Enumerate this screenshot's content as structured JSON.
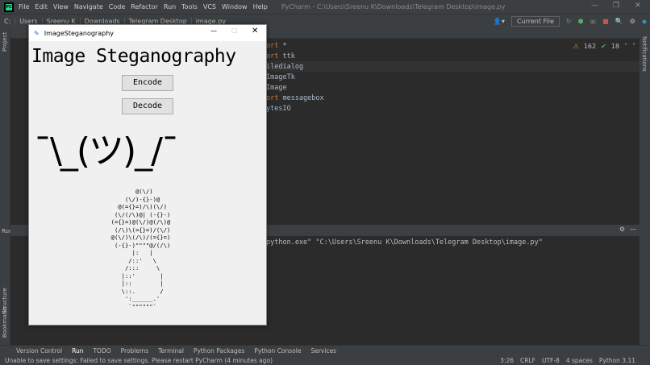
{
  "ide": {
    "menu": [
      "File",
      "Edit",
      "View",
      "Navigate",
      "Code",
      "Refactor",
      "Run",
      "Tools",
      "VCS",
      "Window",
      "Help"
    ],
    "title": "PyCharm - C:\\Users\\Sreenu K\\Downloads\\Telegram Desktop\\image.py",
    "breadcrumbs": [
      "C:",
      "Users",
      "Sreenu K",
      "Downloads",
      "Telegram Desktop",
      "image.py"
    ],
    "run_config": "Current File",
    "warnings": "162",
    "ok_count": "18",
    "code_lines": [
      {
        "kw": "ort",
        "rest": " *"
      },
      {
        "kw": "ort",
        "rest": " ttk"
      },
      {
        "kw": "",
        "rest": "iledialog"
      },
      {
        "kw": "",
        "rest": "ImageTk"
      },
      {
        "kw": "",
        "rest": "Image"
      },
      {
        "kw": "ort",
        "rest": " messagebox"
      },
      {
        "kw": "",
        "rest": "ytesIO"
      }
    ],
    "side_labels": {
      "project": "Project",
      "run": "Run:",
      "structure": "Structure",
      "bookmarks": "Bookmarks",
      "notifications": "Notifications"
    },
    "run_output": "python.exe\" \"C:\\Users\\Sreenu K\\Downloads\\Telegram Desktop\\image.py\"",
    "bottom_tabs": [
      "Version Control",
      "Run",
      "TODO",
      "Problems",
      "Terminal",
      "Python Packages",
      "Python Console",
      "Services"
    ],
    "status_message": "Unable to save settings: Failed to save settings. Please restart PyCharm (4 minutes ago)",
    "status_right": [
      "3:26",
      "CRLF",
      "UTF-8",
      "4 spaces",
      "Python 3.11"
    ]
  },
  "tk": {
    "title": "ImageSteganography",
    "heading": "Image Steganography",
    "encode": "Encode",
    "decode": "Decode",
    "shrug": "¯\\_(ツ)_/¯",
    "art": "         @(\\/)\n      (\\/)-{}-)@\n    @(={}=)/\\)(\\/)\n   (\\/(/\\)@| (-{}-)\n  (={}=)@(\\/)@(/\\)@\n   (/\\)\\(={}=)/(\\/)\n  @(\\/)\\(/\\)/(={}=)\n   (-{}-)\"\"\"\"@/(/\\)\n        |:   |\n       /::'   \\\n      /:::     \\\n     |::'       |\n     |::        |\n     \\::.       /\n      ':______.'\n       `\"\"\"\"\"\"`"
  }
}
